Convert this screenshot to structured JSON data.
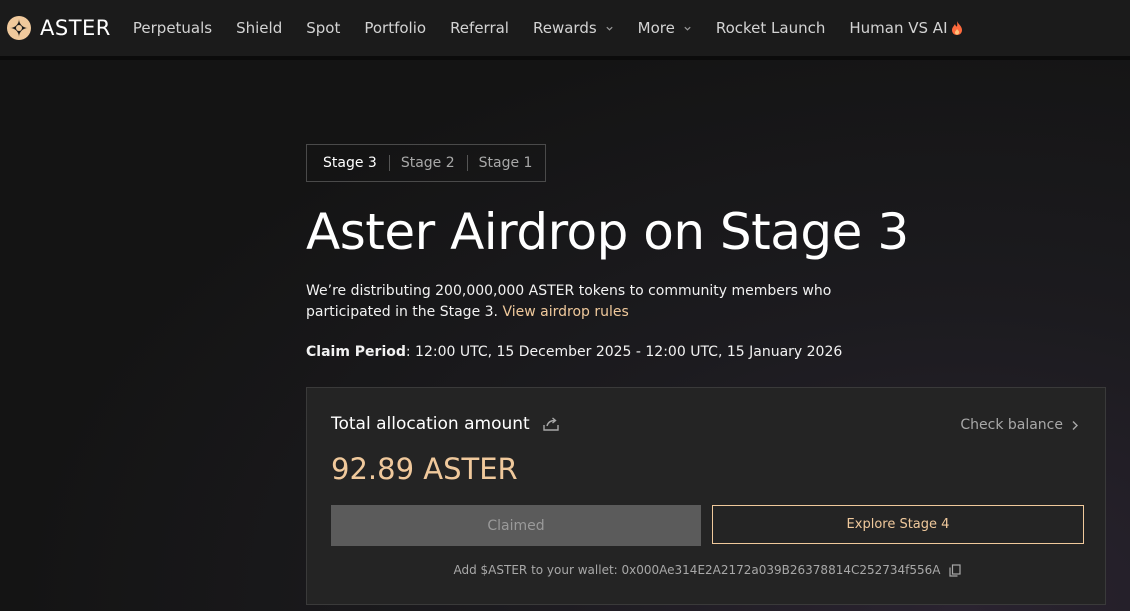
{
  "brand": {
    "name": "ASTER",
    "logo_icon": "aster-logo-icon"
  },
  "nav": {
    "items": [
      {
        "label": "Perpetuals"
      },
      {
        "label": "Shield"
      },
      {
        "label": "Spot"
      },
      {
        "label": "Portfolio"
      },
      {
        "label": "Referral"
      },
      {
        "label": "Rewards",
        "dropdown": true
      },
      {
        "label": "More",
        "dropdown": true
      },
      {
        "label": "Rocket Launch"
      },
      {
        "label": "Human VS AI",
        "icon": "fire-icon"
      }
    ]
  },
  "stages": {
    "tabs": [
      {
        "label": "Stage 3",
        "active": true
      },
      {
        "label": "Stage 2"
      },
      {
        "label": "Stage 1"
      }
    ]
  },
  "hero": {
    "title": "Aster Airdrop on Stage 3",
    "description": "We’re distributing 200,000,000 ASTER tokens to community members who participated in the Stage 3.",
    "rules_link": "View airdrop rules",
    "claim_label": "Claim Period",
    "claim_value": ": 12:00 UTC, 15 December 2025 - 12:00 UTC, 15 January 2026"
  },
  "card": {
    "title": "Total allocation amount",
    "check_balance": "Check balance",
    "amount": "92.89 ASTER",
    "claimed_button": "Claimed",
    "explore_button": "Explore Stage 4",
    "wallet_text": "Add $ASTER to your wallet: 0x000Ae314E2A2172a039B26378814C252734f556A"
  },
  "colors": {
    "accent": "#f0c99c",
    "background": "#141414",
    "card": "#242424"
  }
}
